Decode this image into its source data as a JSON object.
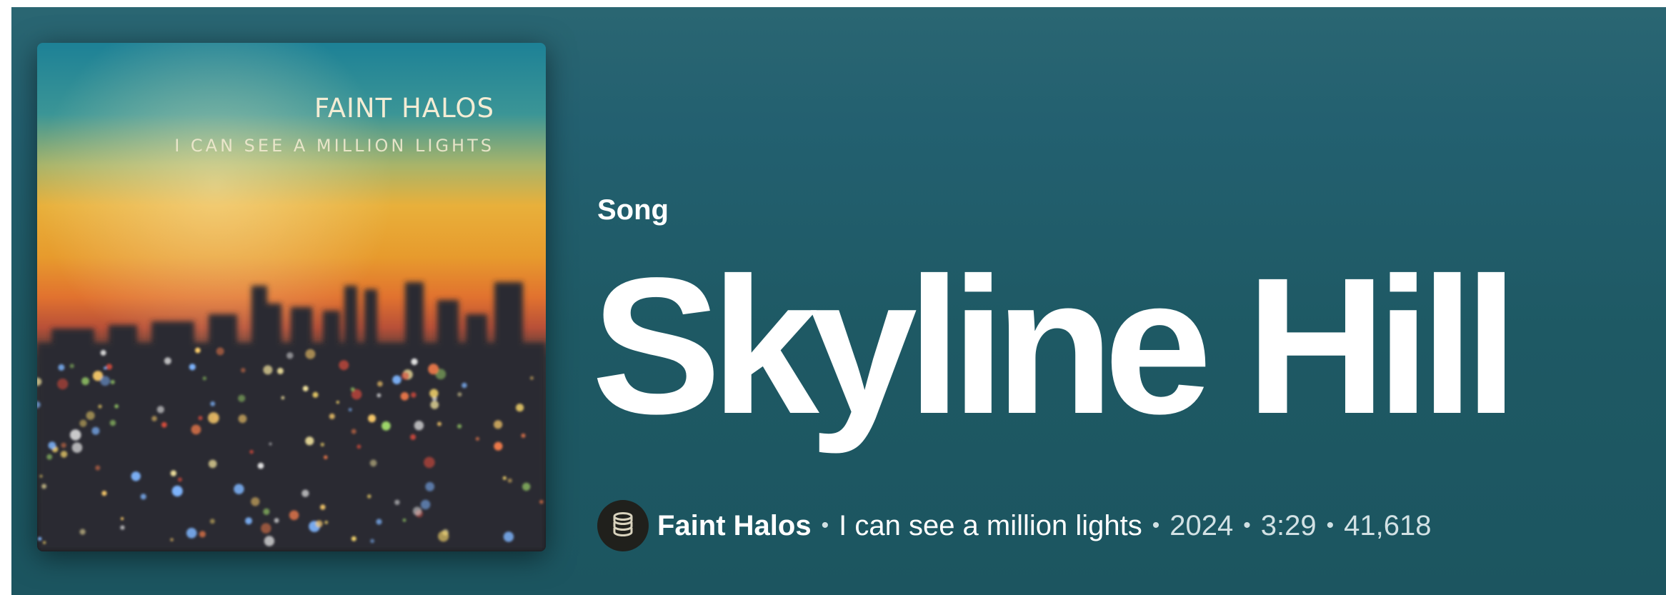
{
  "cover": {
    "title": "FAINT HALOS",
    "subtitle": "I CAN SEE A MILLION LIGHTS"
  },
  "header": {
    "type_label": "Song",
    "title": "Skyline Hill"
  },
  "meta": {
    "artist": "Faint Halos",
    "album": "I can see a million lights",
    "year": "2024",
    "duration": "3:29",
    "plays": "41,618",
    "separator": "•"
  },
  "icons": {
    "artist_avatar": "stacked-discs-icon"
  },
  "colors": {
    "background": "#1e5964",
    "text": "#ffffff",
    "cover_sky_top": "#1f7f93",
    "cover_sky_mid": "#e9a12d",
    "cover_sky_low": "#d9522d"
  }
}
